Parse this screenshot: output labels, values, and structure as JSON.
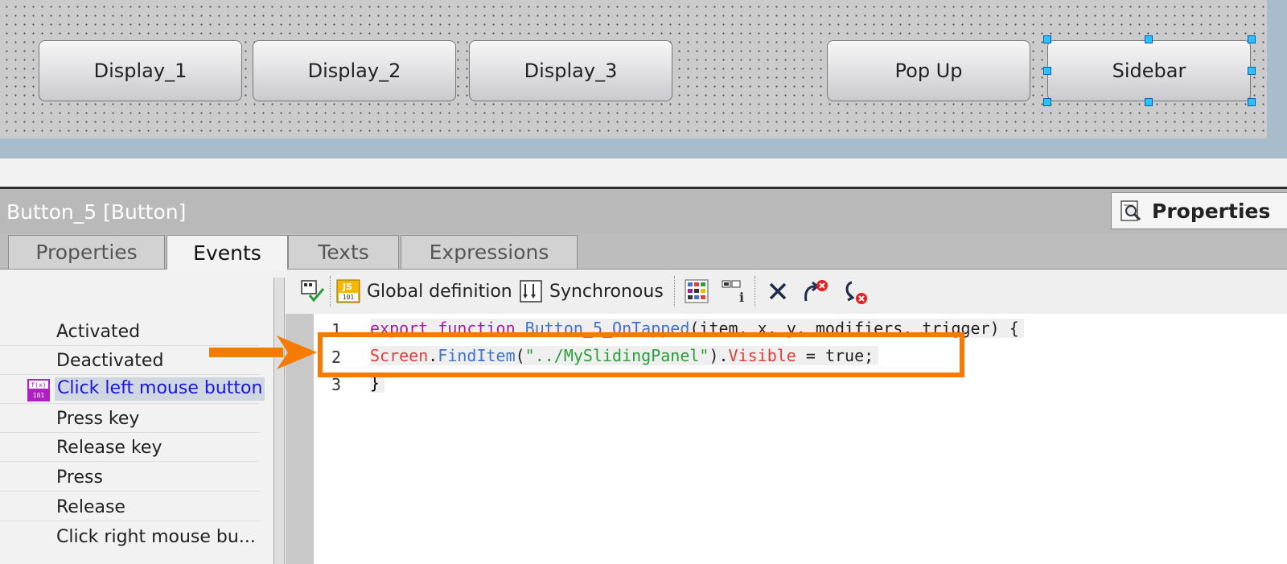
{
  "canvas": {
    "buttons": [
      "Display_1",
      "Display_2",
      "Display_3",
      "Pop Up",
      "Sidebar"
    ],
    "selected_button": "Sidebar"
  },
  "inspector": {
    "title": "Button_5 [Button]",
    "panel_tab": "Properties",
    "tabs": [
      "Properties",
      "Events",
      "Texts",
      "Expressions"
    ],
    "active_tab": "Events"
  },
  "events": {
    "items": [
      "Activated",
      "Deactivated",
      "Click left mouse button",
      "Press key",
      "Release key",
      "Press",
      "Release",
      "Click right mouse bu..."
    ],
    "selected": "Click left mouse button"
  },
  "toolbar": {
    "global_definition": "Global definition",
    "synchronous": "Synchronous"
  },
  "code": {
    "line_numbers": [
      "1",
      "2",
      "3"
    ],
    "line1": {
      "kw": "export function ",
      "fn": "Button_5_OnTapped",
      "rest": "(item, x, y, modifiers, trigger) {"
    },
    "line2": {
      "obj": "Screen",
      "dot1": ".",
      "method": "FindItem",
      "open": "(",
      "arg": "\"../MySlidingPanel\"",
      "close": ").",
      "prop": "Visible",
      "eq": " = ",
      "val": "true;"
    },
    "line3": "}"
  },
  "colors": {
    "highlight": "#f47a00",
    "selected_event_text": "#1b17d6"
  }
}
